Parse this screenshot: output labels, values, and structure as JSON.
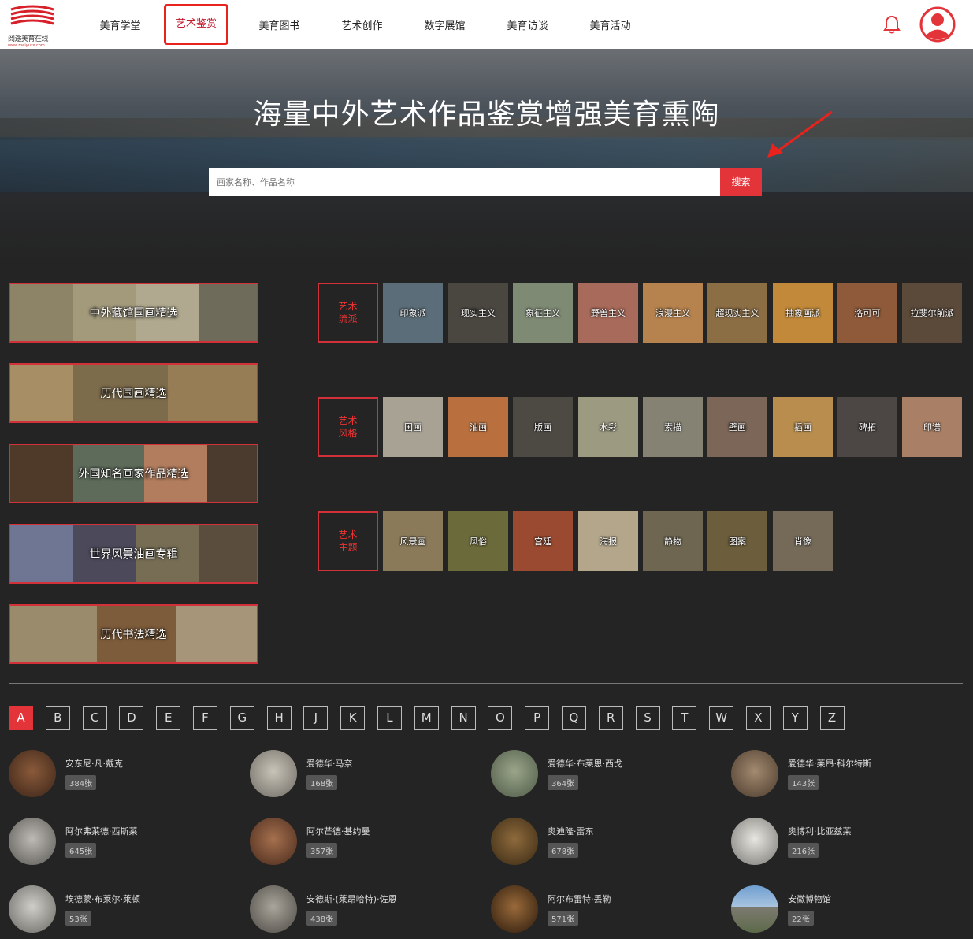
{
  "header": {
    "logo_text": "阅途美育在线",
    "logo_url": "www.meiyuzx.com",
    "nav": [
      "美育学堂",
      "艺术鉴赏",
      "美育图书",
      "艺术创作",
      "数字展馆",
      "美育访谈",
      "美育活动"
    ],
    "active_index": 1
  },
  "hero": {
    "title": "海量中外艺术作品鉴赏增强美育熏陶",
    "search_placeholder": "画家名称、作品名称",
    "search_button": "搜索"
  },
  "collections": [
    "中外藏馆国画精选",
    "历代国画精选",
    "外国知名画家作品精选",
    "世界风景油画专辑",
    "历代书法精选"
  ],
  "categories": {
    "schools": {
      "head": [
        "艺术",
        "流派"
      ],
      "items": [
        "印象派",
        "现实主义",
        "象征主义",
        "野兽主义",
        "浪漫主义",
        "超现实主义",
        "抽象画派",
        "洛可可",
        "拉斐尔前派"
      ]
    },
    "styles": {
      "head": [
        "艺术",
        "风格"
      ],
      "items": [
        "国画",
        "油画",
        "版画",
        "水彩",
        "素描",
        "壁画",
        "插画",
        "碑拓",
        "印谱"
      ]
    },
    "themes": {
      "head": [
        "艺术",
        "主题"
      ],
      "items": [
        "风景画",
        "风俗",
        "宫廷",
        "海报",
        "静物",
        "图案",
        "肖像"
      ]
    }
  },
  "letters": [
    "A",
    "B",
    "C",
    "D",
    "E",
    "F",
    "G",
    "H",
    "J",
    "K",
    "L",
    "M",
    "N",
    "O",
    "P",
    "Q",
    "R",
    "S",
    "T",
    "W",
    "X",
    "Y",
    "Z"
  ],
  "active_letter": "A",
  "artists": [
    {
      "name": "安东尼·凡·戴克",
      "count": "384张"
    },
    {
      "name": "爱德华·马奈",
      "count": "168张"
    },
    {
      "name": "爱德华·布莱恩·西戈",
      "count": "364张"
    },
    {
      "name": "爱德华·莱昂·科尔特斯",
      "count": "143张"
    },
    {
      "name": "阿尔弗莱德·西斯莱",
      "count": "645张"
    },
    {
      "name": "阿尔芒德·基约曼",
      "count": "357张"
    },
    {
      "name": "奥迪隆·雷东",
      "count": "678张"
    },
    {
      "name": "奥博利·比亚兹莱",
      "count": "216张"
    },
    {
      "name": "埃德蒙·布莱尔·莱顿",
      "count": "53张"
    },
    {
      "name": "安德斯·(莱昂哈特)·佐恩",
      "count": "438张"
    },
    {
      "name": "阿尔布雷特·丢勒",
      "count": "571张"
    },
    {
      "name": "安徽博物馆",
      "count": "22张"
    }
  ],
  "colors": {
    "accent": "#e3343a",
    "background": "#242424"
  }
}
